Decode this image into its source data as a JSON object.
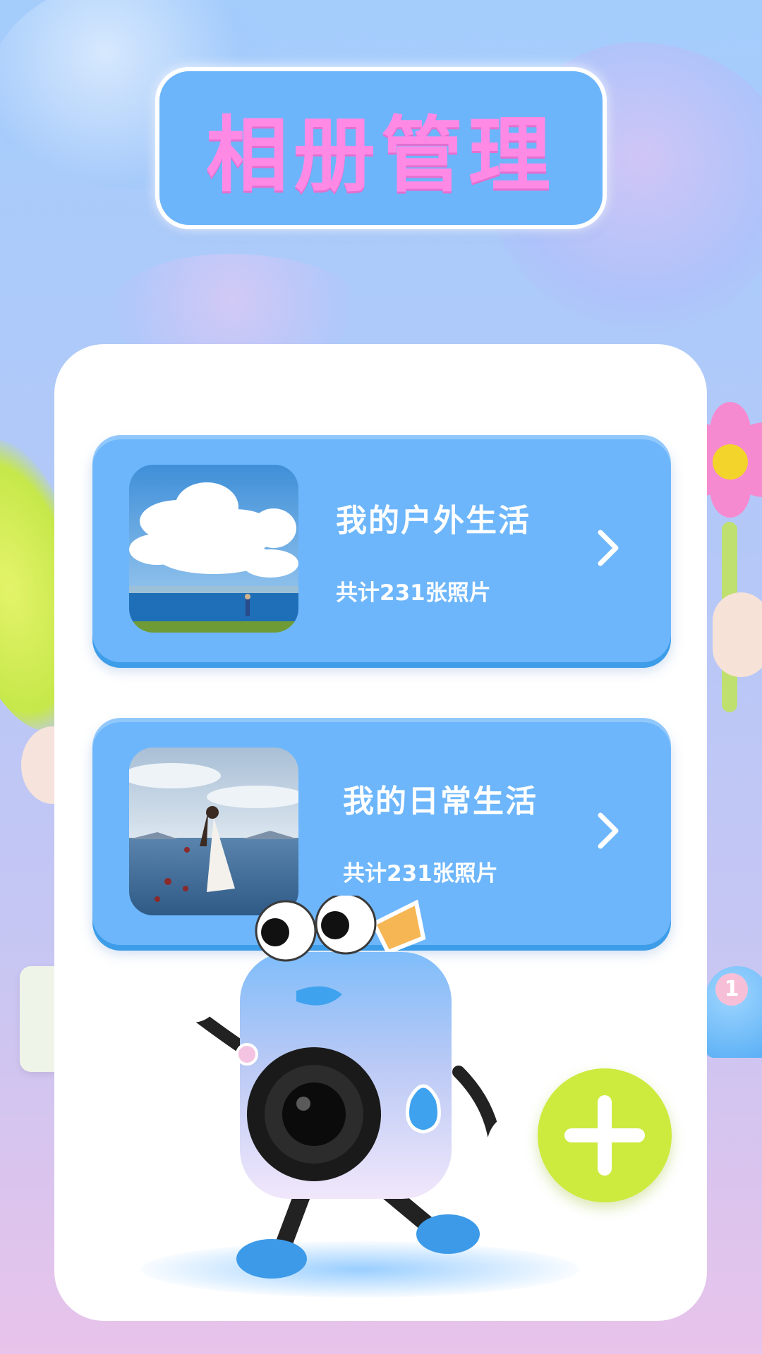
{
  "header": {
    "title": "相册管理"
  },
  "albums": [
    {
      "name": "我的户外生活",
      "count_text": "共计231张照片",
      "thumbnail": "cloudy-seaside-photo"
    },
    {
      "name": "我的日常生活",
      "count_text": "共计231张照片",
      "thumbnail": "woman-in-sea-photo"
    }
  ],
  "add_button": {
    "icon": "plus-icon"
  },
  "decor": {
    "bell_number": "1"
  },
  "colors": {
    "accent_blue": "#6db6fb",
    "title_pink": "#ff8ae6",
    "add_green": "#cdea3f",
    "panel_white": "#ffffff"
  }
}
